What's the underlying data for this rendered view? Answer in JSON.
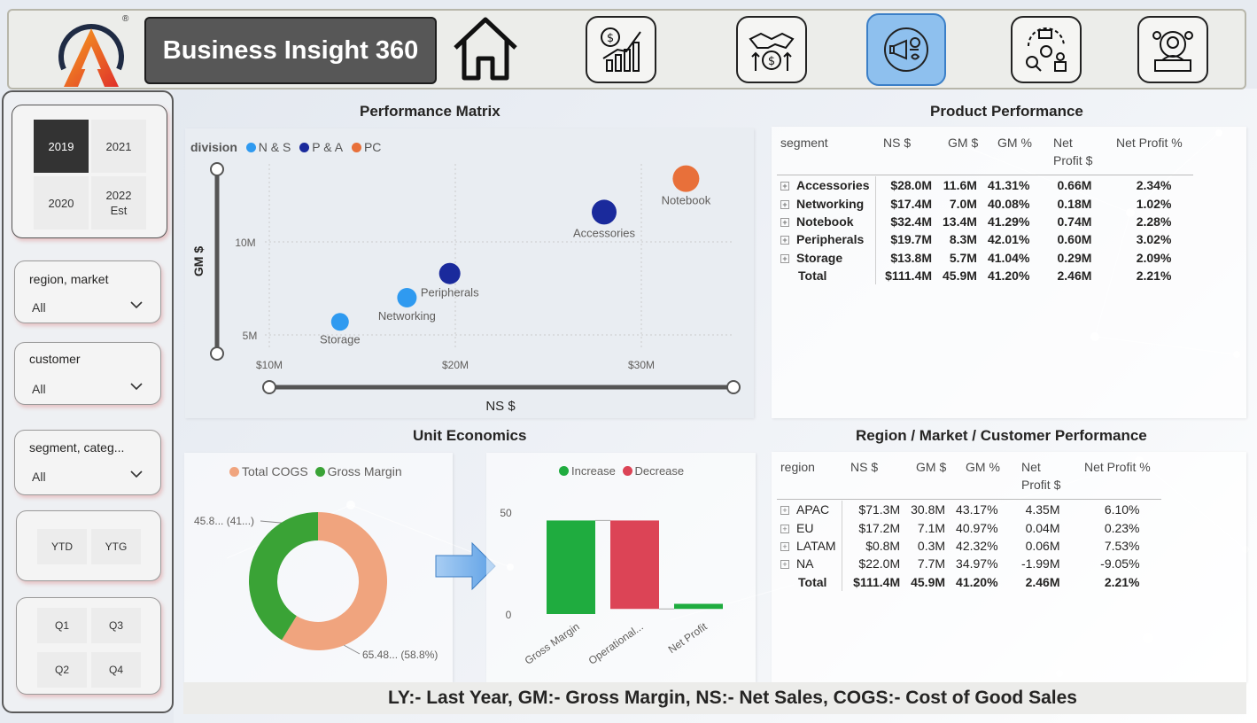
{
  "header": {
    "title": "Business Insight 360",
    "logo_mark": "®",
    "nav": [
      {
        "name": "home-icon"
      },
      {
        "name": "finance-icon"
      },
      {
        "name": "sales-icon"
      },
      {
        "name": "marketing-icon",
        "active": true
      },
      {
        "name": "supply-chain-icon"
      },
      {
        "name": "executive-icon"
      }
    ]
  },
  "sidebar": {
    "years": [
      {
        "line1": "2019",
        "line2": "",
        "selected": true
      },
      {
        "line1": "2021",
        "line2": ""
      },
      {
        "line1": "2020",
        "line2": ""
      },
      {
        "line1": "2022",
        "line2": "Est"
      }
    ],
    "region_label": "region, market",
    "region_value": "All",
    "customer_label": "customer",
    "customer_value": "All",
    "segment_label": "segment, categ...",
    "segment_value": "All",
    "ytd": "YTD",
    "ytg": "YTG",
    "q1": "Q1",
    "q2": "Q2",
    "q3": "Q3",
    "q4": "Q4"
  },
  "performance_matrix": {
    "title": "Performance Matrix",
    "legend_title": "division",
    "legend": [
      {
        "label": "N & S",
        "color": "#2f9af0"
      },
      {
        "label": "P & A",
        "color": "#1a2a9c"
      },
      {
        "label": "PC",
        "color": "#e8703a"
      }
    ],
    "y_label": "GM $",
    "x_label": "NS $",
    "y_ticks": [
      "10M",
      "5M"
    ],
    "x_ticks": [
      "$10M",
      "$20M",
      "$30M"
    ]
  },
  "chart_data": [
    {
      "type": "scatter",
      "title": "Performance Matrix",
      "xlabel": "NS $",
      "ylabel": "GM $",
      "xlim": [
        9.5,
        34
      ],
      "ylim": [
        3.5,
        16
      ],
      "points": [
        {
          "label": "Storage",
          "division": "N & S",
          "x": 13.8,
          "y": 5.7
        },
        {
          "label": "Networking",
          "division": "N & S",
          "x": 17.4,
          "y": 7.0
        },
        {
          "label": "Peripherals",
          "division": "P & A",
          "x": 19.7,
          "y": 8.3
        },
        {
          "label": "Accessories",
          "division": "P & A",
          "x": 28.0,
          "y": 11.6
        },
        {
          "label": "Notebook",
          "division": "PC",
          "x": 32.4,
          "y": 13.4
        }
      ]
    },
    {
      "type": "pie",
      "legend": [
        "Total COGS",
        "Gross Margin"
      ],
      "slices": [
        {
          "label": "Total COGS",
          "value": 58.8,
          "color": "#f0a47e"
        },
        {
          "label": "Gross Margin",
          "value": 41.2,
          "color": "#3aa336"
        }
      ],
      "data_labels": [
        "45.8... (41...)",
        "65.48... (58.8%)"
      ]
    },
    {
      "type": "bar",
      "legend": [
        {
          "label": "Increase",
          "color": "#1fac3f"
        },
        {
          "label": "Decrease",
          "color": "#dc4456"
        }
      ],
      "categories": [
        "Gross Margin",
        "Operational...",
        "Net Profit"
      ],
      "values": [
        45.9,
        -43.4,
        2.5
      ],
      "y_ticks": [
        "50",
        "0"
      ],
      "ylim": [
        0,
        55
      ]
    }
  ],
  "unit_economics": {
    "title": "Unit Economics"
  },
  "product_performance": {
    "title": "Product Performance",
    "headers": [
      "segment",
      "NS $",
      "GM $",
      "GM %",
      "Net Profit $",
      "Net Profit %"
    ],
    "rows": [
      [
        "Accessories",
        "$28.0M",
        "11.6M",
        "41.31%",
        "0.66M",
        "2.34%"
      ],
      [
        "Networking",
        "$17.4M",
        "7.0M",
        "40.08%",
        "0.18M",
        "1.02%"
      ],
      [
        "Notebook",
        "$32.4M",
        "13.4M",
        "41.29%",
        "0.74M",
        "2.28%"
      ],
      [
        "Peripherals",
        "$19.7M",
        "8.3M",
        "42.01%",
        "0.60M",
        "3.02%"
      ],
      [
        "Storage",
        "$13.8M",
        "5.7M",
        "41.04%",
        "0.29M",
        "2.09%"
      ]
    ],
    "total": [
      "Total",
      "$111.4M",
      "45.9M",
      "41.20%",
      "2.46M",
      "2.21%"
    ]
  },
  "region_performance": {
    "title": "Region / Market / Customer Performance",
    "headers": [
      "region",
      "NS $",
      "GM $",
      "GM %",
      "Net Profit $",
      "Net Profit %"
    ],
    "rows": [
      [
        "APAC",
        "$71.3M",
        "30.8M",
        "43.17%",
        "4.35M",
        "6.10%"
      ],
      [
        "EU",
        "$17.2M",
        "7.1M",
        "40.97%",
        "0.04M",
        "0.23%"
      ],
      [
        "LATAM",
        "$0.8M",
        "0.3M",
        "42.32%",
        "0.06M",
        "7.53%"
      ],
      [
        "NA",
        "$22.0M",
        "7.7M",
        "34.97%",
        "-1.99M",
        "-9.05%"
      ]
    ],
    "total": [
      "Total",
      "$111.4M",
      "45.9M",
      "41.20%",
      "2.46M",
      "2.21%"
    ]
  },
  "footer": {
    "text": "LY:- Last Year,  GM:- Gross Margin, NS:- Net Sales, COGS:- Cost of Good Sales"
  }
}
